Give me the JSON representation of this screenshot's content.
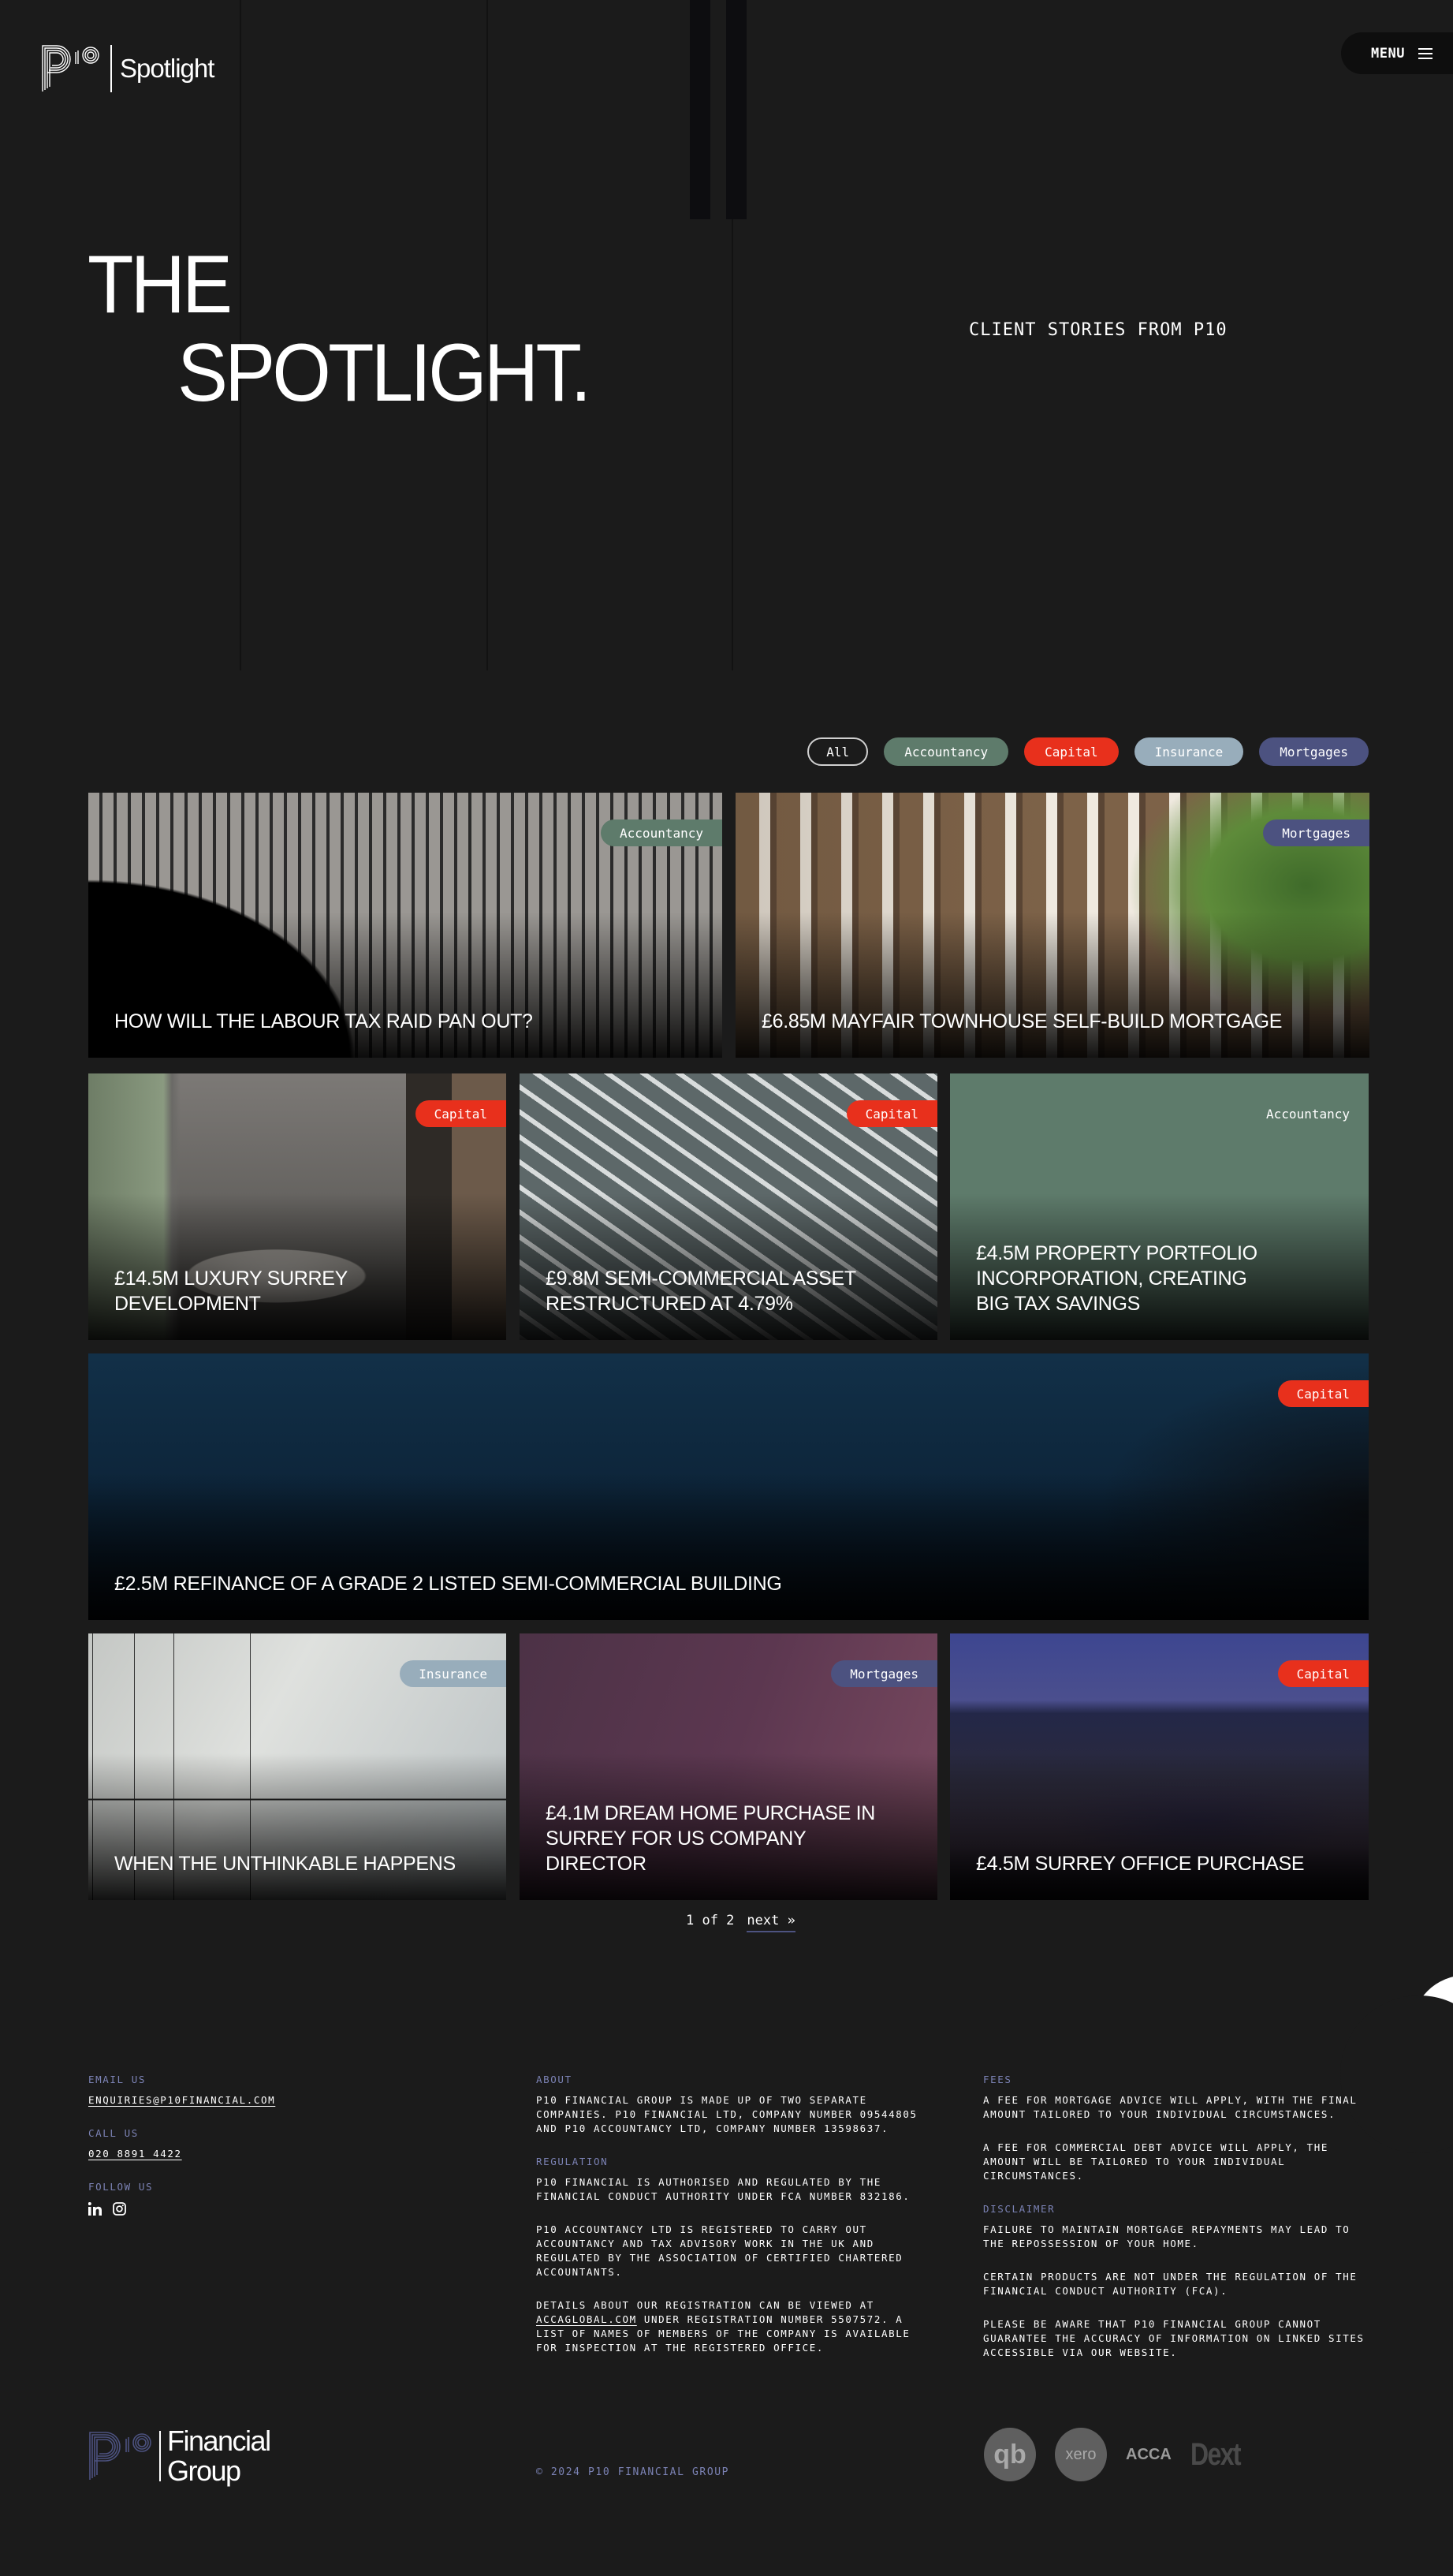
{
  "header": {
    "brand_word": "Spotlight",
    "menu_label": "MENU"
  },
  "hero": {
    "title_line1": "THE",
    "title_line2": "SPOTLIGHT.",
    "subtitle": "CLIENT STORIES FROM P10"
  },
  "filters": [
    {
      "label": "All",
      "color": "transparent",
      "active": true
    },
    {
      "label": "Accountancy",
      "color": "#5e7b6b"
    },
    {
      "label": "Capital",
      "color": "#e8301c"
    },
    {
      "label": "Insurance",
      "color": "#98adbb"
    },
    {
      "label": "Mortgages",
      "color": "#4c5280"
    }
  ],
  "categories": {
    "Accountancy": "#5e7b6b",
    "Capital": "#e8301c",
    "Insurance": "#98adbb",
    "Mortgages": "#4c5280"
  },
  "cards": [
    {
      "title": "How will the Labour tax raid pan out?",
      "category": "Accountancy",
      "image": "concrete-fins-photo"
    },
    {
      "title": "£6.85M Mayfair townhouse self-build mortgage",
      "category": "Mortgages",
      "image": "mews-street-photo"
    },
    {
      "title": "£14.5M luxury Surrey development",
      "category": "Capital",
      "image": "living-room-photo"
    },
    {
      "title": "£9.8M semi-commercial asset restructured at 4.79%",
      "category": "Capital",
      "image": "building-facade-photo"
    },
    {
      "title": "£4.5M property portfolio incorporation, creating big tax savings",
      "category": "Accountancy",
      "image": "solid-green"
    },
    {
      "title": "£2.5M refinance of a Grade 2 listed semi-commercial building",
      "category": "Capital",
      "image": "dark-ocean-photo"
    },
    {
      "title": "When the unthinkable happens",
      "category": "Insurance",
      "image": "cladding-panels-photo"
    },
    {
      "title": "£4.1M dream home purchase in Surrey for US company director",
      "category": "Mortgages",
      "image": "purple-gradient"
    },
    {
      "title": "£4.5M Surrey office purchase",
      "category": "Capital",
      "image": "london-night-photo"
    }
  ],
  "pagination": {
    "status": "1 of 2",
    "next_label": "next »"
  },
  "footer": {
    "contact": {
      "email_label": "EMAIL US",
      "email": "ENQUIRIES@P10FINANCIAL.COM",
      "call_label": "CALL US",
      "phone": "020 8891 4422",
      "follow_label": "FOLLOW US",
      "social": [
        "linkedin-icon",
        "instagram-icon"
      ]
    },
    "about": {
      "label": "ABOUT",
      "text": "P10 FINANCIAL GROUP IS MADE UP OF TWO SEPARATE COMPANIES. P10 FINANCIAL LTD, COMPANY NUMBER 09544805 AND P10 ACCOUNTANCY LTD, COMPANY NUMBER 13598637."
    },
    "regulation": {
      "label": "REGULATION",
      "p1": "P10 FINANCIAL IS AUTHORISED AND REGULATED BY THE FINANCIAL CONDUCT AUTHORITY UNDER FCA NUMBER 832186.",
      "p2": "P10 ACCOUNTANCY LTD IS REGISTERED TO CARRY OUT ACCOUNTANCY AND TAX ADVISORY WORK IN THE UK AND REGULATED BY THE ASSOCIATION OF CERTIFIED CHARTERED ACCOUNTANTS.",
      "p3_before": "DETAILS ABOUT OUR REGISTRATION CAN BE VIEWED AT",
      "p3_link": "ACCAGLOBAL.COM",
      "p3_after": "UNDER REGISTRATION NUMBER 5507572. A LIST OF NAMES OF MEMBERS OF THE COMPANY IS AVAILABLE FOR INSPECTION AT THE REGISTERED OFFICE."
    },
    "fees": {
      "label": "FEES",
      "p1": "A FEE FOR MORTGAGE ADVICE WILL APPLY, WITH THE FINAL AMOUNT TAILORED TO YOUR INDIVIDUAL CIRCUMSTANCES.",
      "p2": "A FEE FOR COMMERCIAL DEBT ADVICE WILL APPLY, THE AMOUNT WILL BE TAILORED TO YOUR INDIVIDUAL CIRCUMSTANCES."
    },
    "disclaimer": {
      "label": "DISCLAIMER",
      "p1": "FAILURE TO MAINTAIN MORTGAGE REPAYMENTS MAY LEAD TO THE REPOSSESSION OF YOUR HOME.",
      "p2": "CERTAIN PRODUCTS ARE NOT UNDER THE REGULATION OF THE FINANCIAL CONDUCT AUTHORITY (FCA).",
      "p3": "PLEASE BE AWARE THAT P10 FINANCIAL GROUP CANNOT GUARANTEE THE ACCURACY OF INFORMATION ON LINKED SITES ACCESSIBLE VIA OUR WEBSITE."
    },
    "brand_line1": "Financial",
    "brand_line2": "Group",
    "copyright": "© 2024 P10 FINANCIAL GROUP",
    "partners": {
      "qb": "qb",
      "xero": "xero",
      "acca": "ACCA",
      "dext": "Dext"
    }
  }
}
